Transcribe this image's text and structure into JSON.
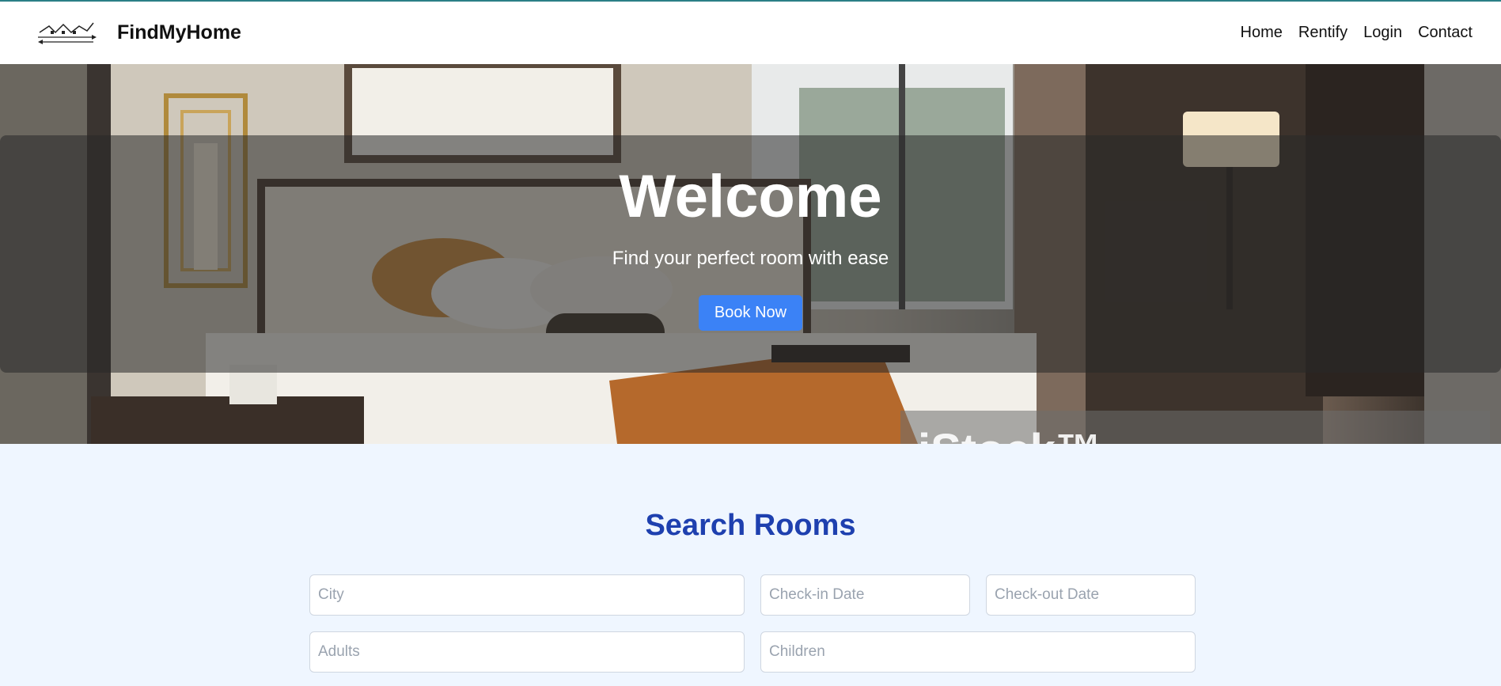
{
  "nav": {
    "brand": "FindMyHome",
    "links": [
      "Home",
      "Rentify",
      "Login",
      "Contact"
    ]
  },
  "hero": {
    "title": "Welcome",
    "subtitle": "Find your perfect room with ease",
    "cta_label": "Book Now",
    "watermark": "iStock™"
  },
  "search": {
    "title": "Search Rooms",
    "city_placeholder": "City",
    "checkin_placeholder": "Check-in Date",
    "checkout_placeholder": "Check-out Date",
    "adults_placeholder": "Adults",
    "children_placeholder": "Children"
  },
  "colors": {
    "accent": "#3b82f6",
    "title_blue": "#1e40af",
    "section_bg": "#eff6ff"
  }
}
